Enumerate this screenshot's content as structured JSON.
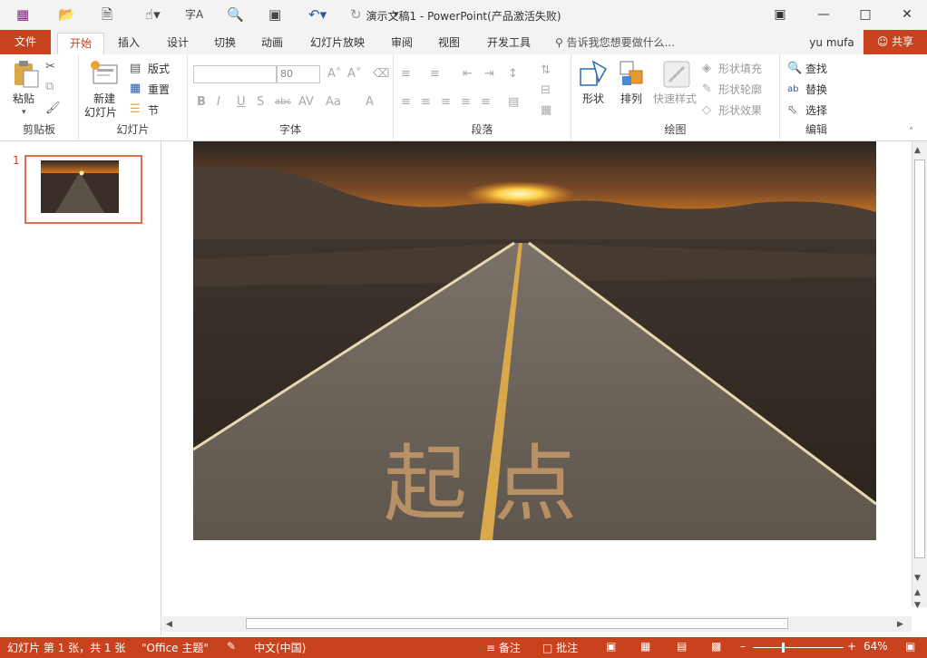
{
  "window": {
    "title": "演示文稿1 - PowerPoint(产品激活失败)"
  },
  "tabs": {
    "file": "文件",
    "items": [
      "开始",
      "插入",
      "设计",
      "切换",
      "动画",
      "幻灯片放映",
      "审阅",
      "视图",
      "开发工具"
    ],
    "tellme": "告诉我您想要做什么...",
    "user": "yu mufa",
    "share": "共享"
  },
  "ribbon": {
    "clipboard": {
      "paste": "粘贴",
      "label": "剪贴板"
    },
    "slides": {
      "new_slide_line1": "新建",
      "new_slide_line2": "幻灯片",
      "layout": "版式",
      "reset": "重置",
      "section": "节",
      "label": "幻灯片"
    },
    "font": {
      "size": "80",
      "label": "字体"
    },
    "paragraph": {
      "label": "段落"
    },
    "drawing": {
      "shapes": "形状",
      "arrange": "排列",
      "quick_styles": "快速样式",
      "fill": "形状填充",
      "outline": "形状轮廓",
      "effects": "形状效果",
      "label": "绘图"
    },
    "editing": {
      "find": "查找",
      "replace": "替换",
      "select": "选择",
      "label": "编辑"
    }
  },
  "slide_panel": {
    "number": "1"
  },
  "slide": {
    "overlay_text": "起 点"
  },
  "status": {
    "slide_info": "幻灯片 第 1 张，共 1 张",
    "theme": "\"Office 主题\"",
    "language": "中文(中国)",
    "notes": "备注",
    "comments": "批注",
    "zoom": "64%"
  },
  "colors": {
    "accent": "#c9421e"
  }
}
